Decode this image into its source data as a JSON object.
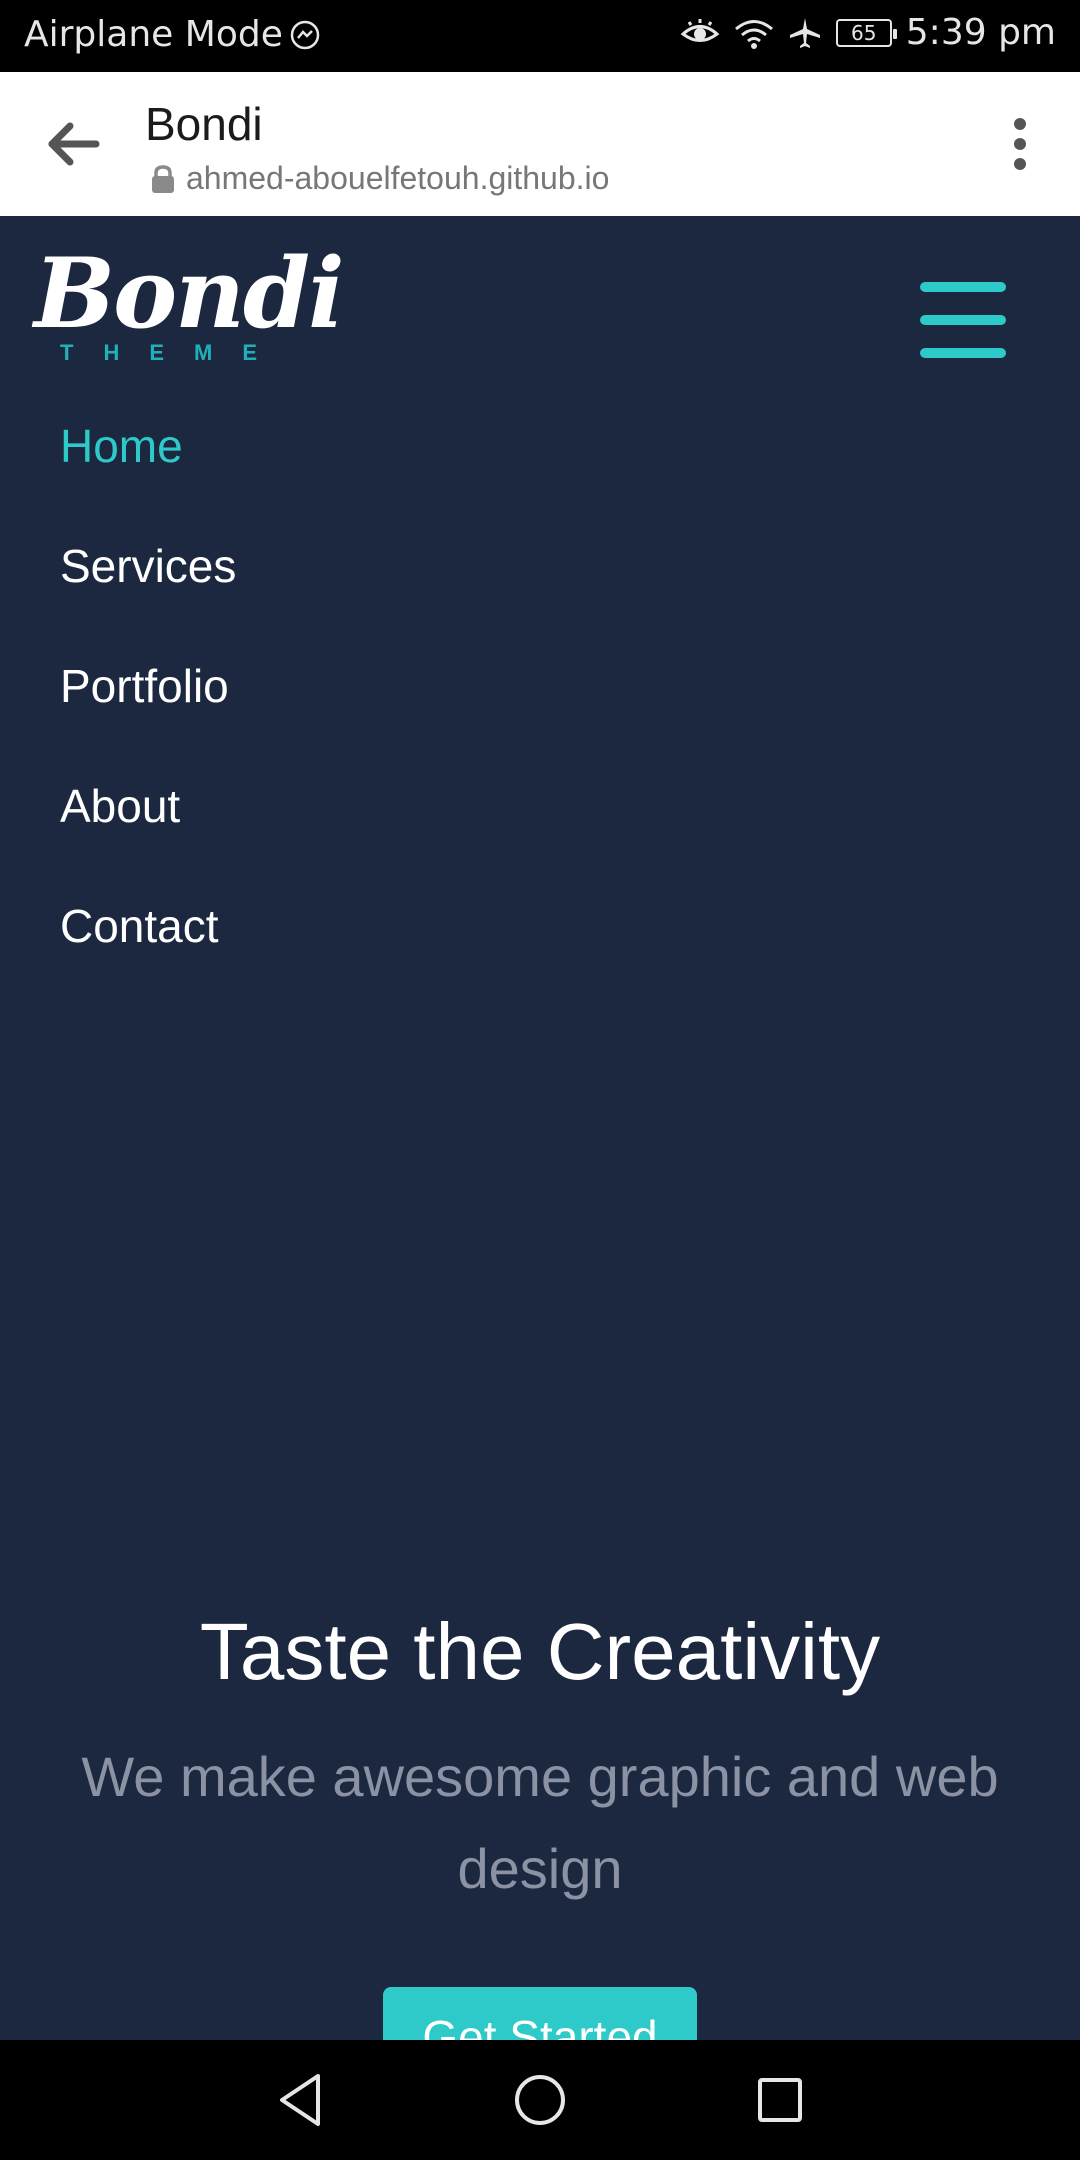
{
  "status_bar": {
    "left_text": "Airplane Mode",
    "battery": "65",
    "time": "5:39 pm"
  },
  "browser": {
    "title": "Bondi",
    "url": "ahmed-abouelfetouh.github.io"
  },
  "site": {
    "logo": {
      "script": "Bondi",
      "sub": "THEME"
    },
    "nav_items": [
      "Home",
      "Services",
      "Portfolio",
      "About",
      "Contact"
    ],
    "hero_title": "Taste the Creativity",
    "hero_subtitle": "We make awesome graphic and web design",
    "cta_label": "Get Started"
  },
  "colors": {
    "background": "#1c2740",
    "accent": "#2ec9c9",
    "subtitle": "#8b92a3"
  }
}
